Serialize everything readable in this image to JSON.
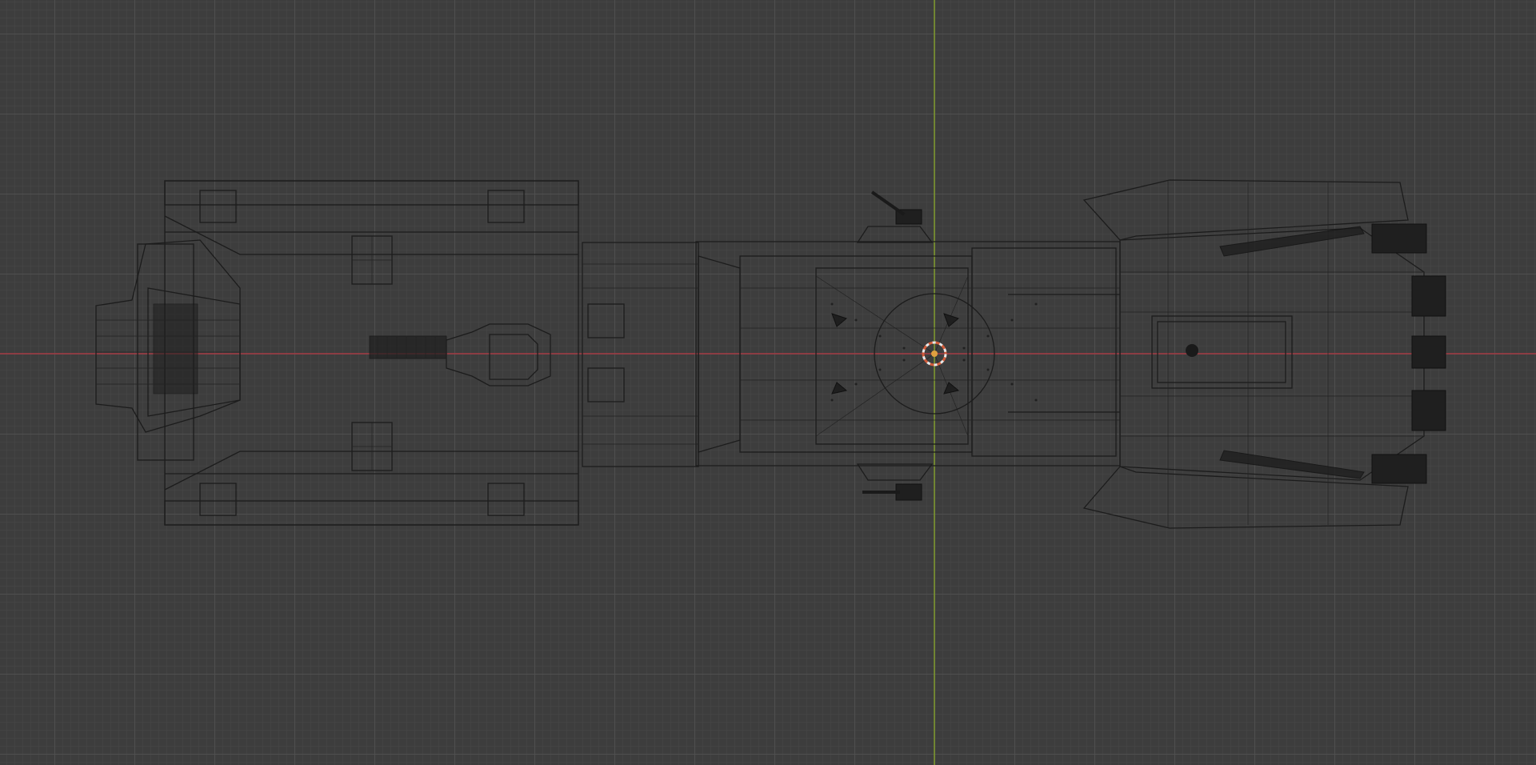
{
  "viewport": {
    "view": "top-orthographic",
    "shading": "wireframe",
    "colors": {
      "background": "#3d3d3d",
      "grid": "#505050",
      "x_axis": "#a43a43",
      "y_axis": "#7f9a2c",
      "wire": "#1c1c1c",
      "origin_outer": "#e8e8e8",
      "origin_inner": "#d35c3a"
    }
  },
  "object": {
    "icon": "3d-object-icon",
    "parts": [
      "rear-engine-block",
      "rear-nozzle",
      "rear-turret",
      "connector",
      "cockpit-module",
      "side-turret-top",
      "side-turret-bottom",
      "front-module",
      "front-pods"
    ]
  },
  "origin": {
    "icon": "3d-cursor-icon"
  }
}
